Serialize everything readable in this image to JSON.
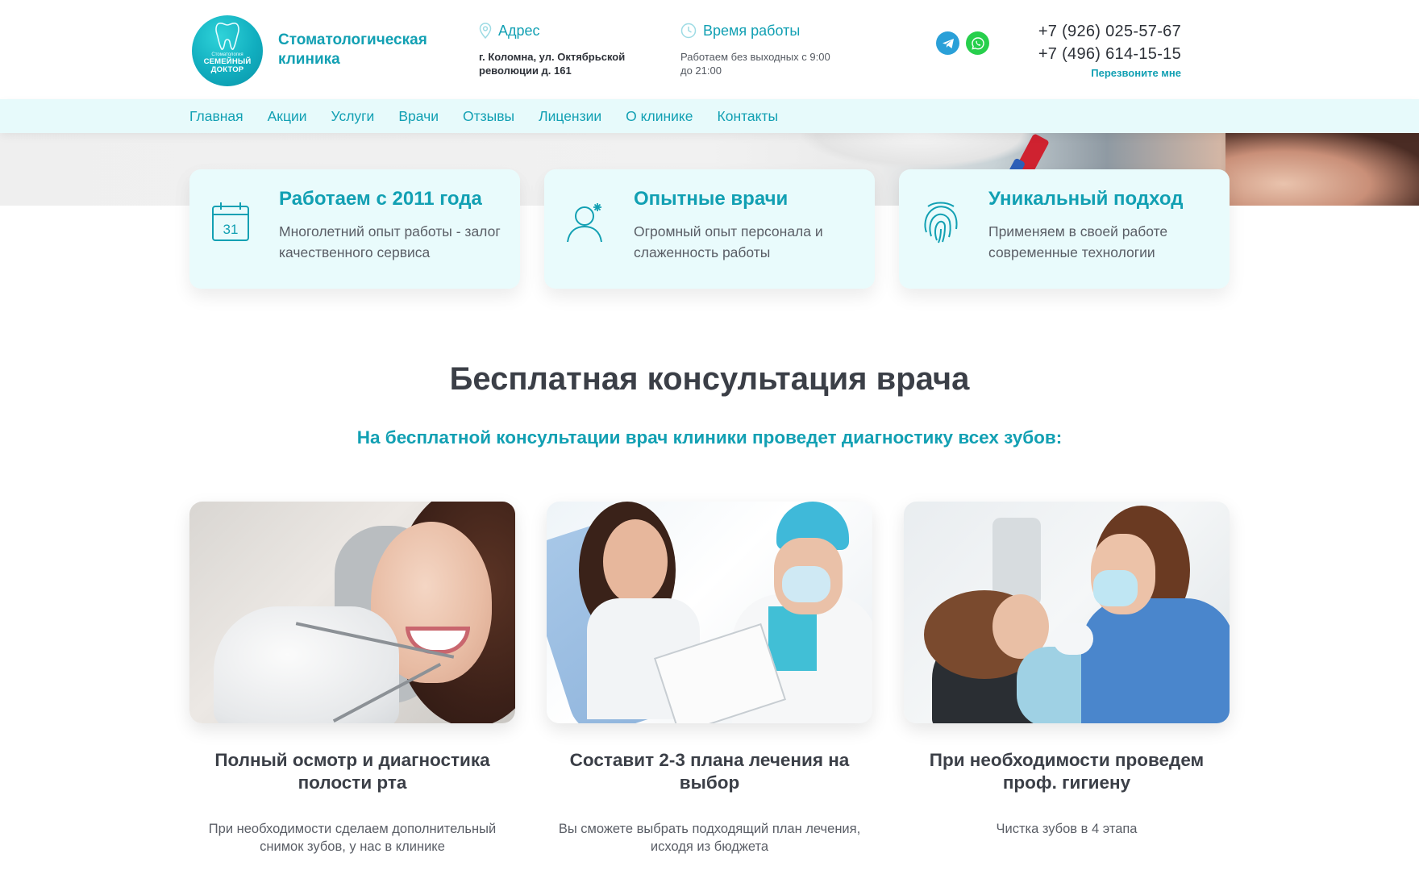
{
  "header": {
    "logo": {
      "small": "Стоматология",
      "line1": "СЕМЕЙНЫЙ",
      "line2": "ДОКТОР"
    },
    "clinic_title": "Стоматологическая клиника",
    "address": {
      "label": "Адрес",
      "text": "г. Коломна, ул. Октябрьской революции д. 161",
      "icon": "location-pin-icon"
    },
    "hours": {
      "label": "Время работы",
      "text": "Работаем без выходных с 9:00 до 21:00",
      "icon": "clock-icon"
    },
    "messengers": [
      "telegram-icon",
      "whatsapp-icon"
    ],
    "phones": [
      "+7 (926) 025-57-67",
      "+7 (496) 614-15-15"
    ],
    "callback": "Перезвоните мне"
  },
  "nav": {
    "items": [
      "Главная",
      "Акции",
      "Услуги",
      "Врачи",
      "Отзывы",
      "Лицензии",
      "О клинике",
      "Контакты"
    ]
  },
  "features": [
    {
      "icon": "calendar-icon",
      "icon_text": "31",
      "title": "Работаем с 2011 года",
      "text": "Многолетний опыт работы - залог качественного сервиса"
    },
    {
      "icon": "doctor-icon",
      "title": "Опытные врачи",
      "text": "Огромный опыт персонала и слаженность работы"
    },
    {
      "icon": "fingerprint-icon",
      "title": "Уникальный подход",
      "text": "Применяем в своей работе современные технологии"
    }
  ],
  "consultation": {
    "title": "Бесплатная консультация врача",
    "subtitle": "На бесплатной консультации врач клиники проведет диагностику всех зубов:",
    "cards": [
      {
        "title": "Полный осмотр и диагностика полости рта",
        "text": "При необходимости сделаем дополнительный снимок зубов, у нас в клинике"
      },
      {
        "title": "Составит 2-3 плана лечения на выбор",
        "text": "Вы сможете выбрать подходящий план лечения, исходя из бюджета"
      },
      {
        "title": "При необходимости проведем проф. гигиену",
        "text": "Чистка зубов в 4 этапа"
      }
    ]
  },
  "colors": {
    "accent": "#12a0b3",
    "text": "#3b3f47",
    "card_bg": "#e9fbfc",
    "nav_bg": "#e7fafb"
  }
}
